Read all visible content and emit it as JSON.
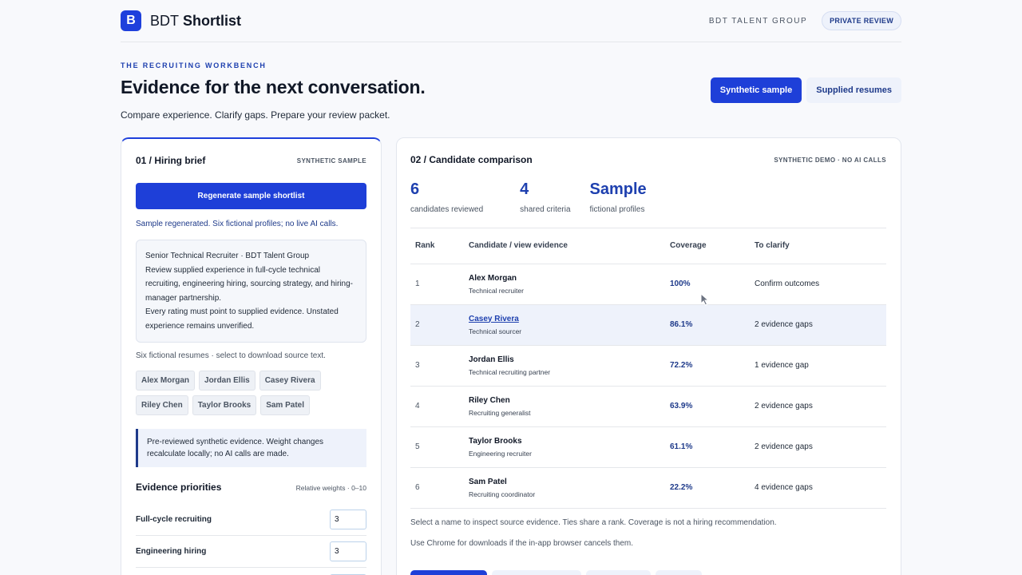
{
  "header": {
    "logo_letter": "B",
    "brand_prefix": "BDT",
    "brand_suffix": "Shortlist",
    "org": "BDT TALENT GROUP",
    "badge": "PRIVATE REVIEW"
  },
  "hero": {
    "eyebrow": "THE RECRUITING WORKBENCH",
    "title": "Evidence for the next conversation.",
    "subtitle": "Compare experience. Clarify gaps. Prepare your review packet.",
    "mode_active": "Synthetic sample",
    "mode_inactive": "Supplied resumes"
  },
  "brief": {
    "title": "01 / Hiring brief",
    "tag": "SYNTHETIC SAMPLE",
    "regen_label": "Regenerate sample shortlist",
    "status": "Sample regenerated. Six fictional profiles; no live AI calls.",
    "text_1": "Senior Technical Recruiter · BDT Talent Group",
    "text_2": "Review supplied experience in full-cycle technical recruiting, engineering hiring, sourcing strategy, and hiring-manager partnership.",
    "text_3": "Every rating must point to supplied evidence. Unstated experience remains unverified.",
    "resumes_hint": "Six fictional resumes · select to download source text.",
    "resumes": [
      "Alex Morgan",
      "Jordan Ellis",
      "Casey Rivera",
      "Riley Chen",
      "Taylor Brooks",
      "Sam Patel"
    ],
    "note": "Pre-reviewed synthetic evidence. Weight changes recalculate locally; no AI calls are made.",
    "priorities_title": "Evidence priorities",
    "priorities_sub": "Relative weights · 0–10",
    "priorities": [
      {
        "label": "Full-cycle recruiting",
        "value": "3"
      },
      {
        "label": "Engineering hiring",
        "value": "3"
      }
    ]
  },
  "comparison": {
    "title": "02 / Candidate comparison",
    "tag": "SYNTHETIC DEMO · NO AI CALLS",
    "stats": [
      {
        "num": "6",
        "cap": "candidates reviewed"
      },
      {
        "num": "4",
        "cap": "shared criteria"
      },
      {
        "num": "Sample",
        "cap": "fictional profiles"
      }
    ],
    "columns": [
      "Rank",
      "Candidate / view evidence",
      "Coverage",
      "To clarify"
    ],
    "rows": [
      {
        "rank": "1",
        "name": "Alex Morgan",
        "role": "Technical recruiter",
        "coverage": "100%",
        "clarify": "Confirm outcomes"
      },
      {
        "rank": "2",
        "name": "Casey Rivera",
        "role": "Technical sourcer",
        "coverage": "86.1%",
        "clarify": "2 evidence gaps"
      },
      {
        "rank": "3",
        "name": "Jordan Ellis",
        "role": "Technical recruiting partner",
        "coverage": "72.2%",
        "clarify": "1 evidence gap"
      },
      {
        "rank": "4",
        "name": "Riley Chen",
        "role": "Recruiting generalist",
        "coverage": "63.9%",
        "clarify": "2 evidence gaps"
      },
      {
        "rank": "5",
        "name": "Taylor Brooks",
        "role": "Engineering recruiter",
        "coverage": "61.1%",
        "clarify": "2 evidence gaps"
      },
      {
        "rank": "6",
        "name": "Sam Patel",
        "role": "Recruiting coordinator",
        "coverage": "22.2%",
        "clarify": "4 evidence gaps"
      }
    ],
    "foot_1": "Select a name to inspect source evidence. Ties share a rank. Coverage is not a hiring recommendation.",
    "foot_2": "Use Chrome for downloads if the in-app browser cancels them."
  },
  "colors": {
    "accent": "#1e3fd8",
    "accent_dark": "#1e3a8a",
    "selected_row": "#eef2fb"
  }
}
